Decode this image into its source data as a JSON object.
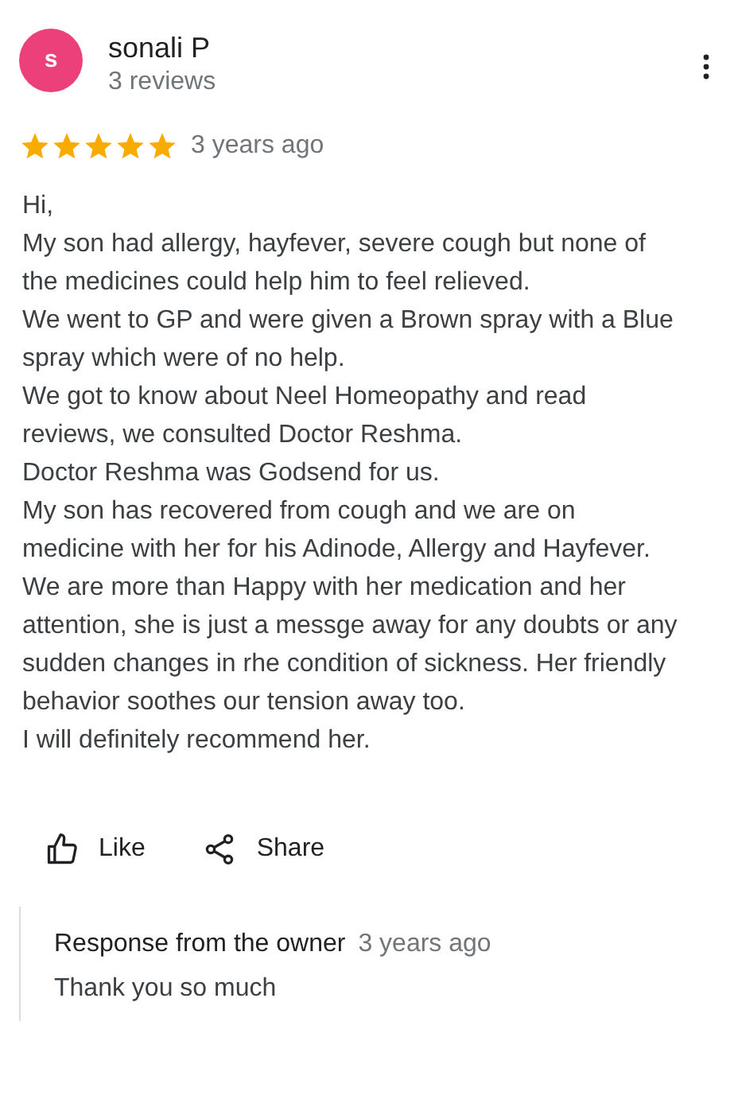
{
  "reviewer": {
    "initial": "s",
    "name": "sonali P",
    "reviews": "3 reviews"
  },
  "rating": {
    "stars": 5,
    "time": "3 years ago"
  },
  "body": [
    "Hi,",
    "My son had allergy, hayfever, severe cough but none of the medicines could help him to feel relieved.",
    "We went to GP and were given a Brown spray with a Blue spray which were of no help.",
    "We got to know about Neel Homeopathy and read reviews, we consulted Doctor Reshma.",
    "Doctor Reshma was Godsend for us.",
    "My son has recovered from cough and we are on medicine with her for his Adinode, Allergy and Hayfever.",
    "We are more than Happy with her medication and her attention, she is just a messge away for any doubts or any sudden changes in rhe condition of sickness. Her friendly behavior soothes our tension away too.",
    "I will definitely recommend her."
  ],
  "actions": [
    {
      "kind": "like",
      "label": "Like"
    },
    {
      "kind": "share",
      "label": "Share"
    }
  ],
  "owner_response": {
    "title": "Response from the owner",
    "time": "3 years ago",
    "text": "Thank you so much"
  }
}
